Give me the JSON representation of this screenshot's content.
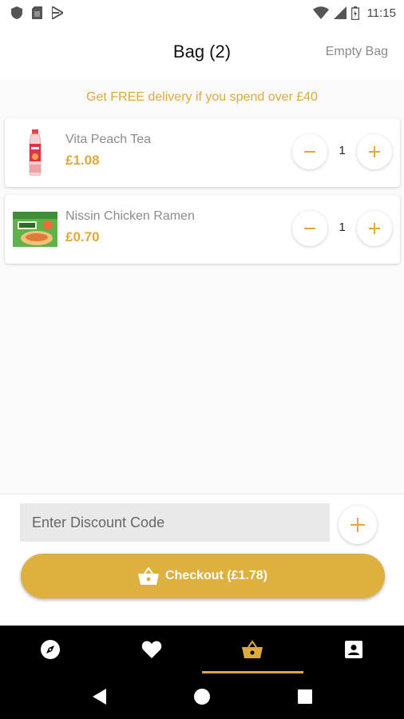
{
  "status_bar": {
    "time": "11:15",
    "left_icons": [
      "shield-icon",
      "sim-card-icon",
      "play-store-icon"
    ],
    "right_icons": [
      "wifi-icon",
      "signal-icon",
      "battery-icon"
    ]
  },
  "header": {
    "title": "Bag (2)",
    "empty_bag_label": "Empty Bag"
  },
  "banner": {
    "text": "Get FREE delivery if you spend over £40"
  },
  "items": [
    {
      "name": "Vita Peach Tea",
      "price": "£1.08",
      "quantity": "1",
      "thumb_icon": "peach-tea-bottle-icon"
    },
    {
      "name": "Nissin Chicken Ramen",
      "price": "£0.70",
      "quantity": "1",
      "thumb_icon": "ramen-pack-icon"
    }
  ],
  "discount": {
    "placeholder": "Enter Discount Code",
    "value": ""
  },
  "checkout": {
    "label": "Checkout (£1.78)"
  },
  "bottom_nav": {
    "items": [
      "explore-icon",
      "heart-icon",
      "basket-icon",
      "account-icon"
    ],
    "active_index": 2
  },
  "colors": {
    "accent": "#dcab3b",
    "checkout_bg": "#ddb040",
    "nav_bg": "#000000"
  }
}
